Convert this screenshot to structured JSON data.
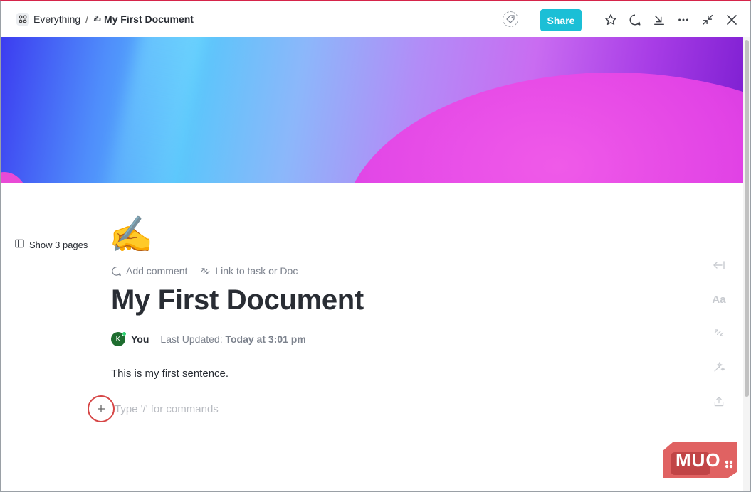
{
  "breadcrumb": {
    "space": "Everything",
    "separator": "/",
    "doc_emoji": "✍",
    "doc_title": "My First Document"
  },
  "toolbar": {
    "share_label": "Share"
  },
  "sidebar": {
    "show_pages_label": "Show 3 pages"
  },
  "document": {
    "emoji": "✍️",
    "add_comment_label": "Add comment",
    "link_label": "Link to task or Doc",
    "title": "My First Document",
    "author_initial": "K",
    "author_name": "You",
    "updated_label": "Last Updated:",
    "updated_value": "Today at 3:01 pm",
    "body_text": "This is my first sentence.",
    "command_placeholder": "Type '/' for commands"
  },
  "right_rail": {
    "text_style_label": "Aa"
  },
  "watermark": {
    "text": "MUO"
  },
  "colors": {
    "accent_share": "#1bbfd6",
    "window_top_border": "#d6244a",
    "avatar_bg": "#1e6d2f",
    "highlight_ring": "#d64545"
  }
}
